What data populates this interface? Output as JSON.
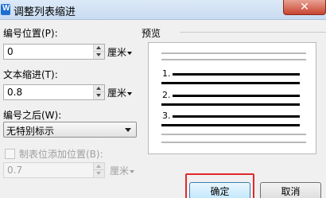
{
  "window": {
    "title": "调整列表缩进",
    "close_glyph": "✕",
    "app_icon_glyph": "W"
  },
  "form": {
    "number_position": {
      "label": "编号位置(P):",
      "value": "0",
      "unit": "厘米"
    },
    "text_indent": {
      "label": "文本缩进(T):",
      "value": "0.8",
      "unit": "厘米"
    },
    "follow_number": {
      "label": "编号之后(W):",
      "selected": "无特别标示"
    },
    "tab_stop": {
      "label": "制表位添加位置(B):",
      "checked": false,
      "value": "0.7",
      "unit": "厘米"
    }
  },
  "preview": {
    "title": "预览",
    "numbers": [
      "1.",
      "2.",
      "3."
    ]
  },
  "buttons": {
    "ok": "确定",
    "cancel": "取消"
  },
  "colors": {
    "highlight": "#e0292a",
    "close_button": "#c8442f",
    "titlebar": "#dce9f7"
  }
}
